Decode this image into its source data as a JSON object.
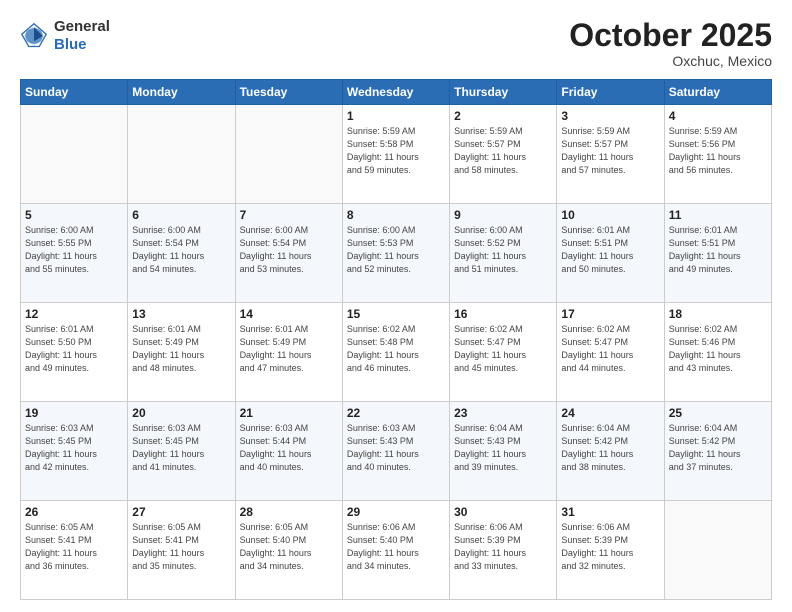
{
  "header": {
    "logo_general": "General",
    "logo_blue": "Blue",
    "month_title": "October 2025",
    "location": "Oxchuc, Mexico"
  },
  "weekdays": [
    "Sunday",
    "Monday",
    "Tuesday",
    "Wednesday",
    "Thursday",
    "Friday",
    "Saturday"
  ],
  "weeks": [
    [
      {
        "day": "",
        "info": ""
      },
      {
        "day": "",
        "info": ""
      },
      {
        "day": "",
        "info": ""
      },
      {
        "day": "1",
        "info": "Sunrise: 5:59 AM\nSunset: 5:58 PM\nDaylight: 11 hours\nand 59 minutes."
      },
      {
        "day": "2",
        "info": "Sunrise: 5:59 AM\nSunset: 5:57 PM\nDaylight: 11 hours\nand 58 minutes."
      },
      {
        "day": "3",
        "info": "Sunrise: 5:59 AM\nSunset: 5:57 PM\nDaylight: 11 hours\nand 57 minutes."
      },
      {
        "day": "4",
        "info": "Sunrise: 5:59 AM\nSunset: 5:56 PM\nDaylight: 11 hours\nand 56 minutes."
      }
    ],
    [
      {
        "day": "5",
        "info": "Sunrise: 6:00 AM\nSunset: 5:55 PM\nDaylight: 11 hours\nand 55 minutes."
      },
      {
        "day": "6",
        "info": "Sunrise: 6:00 AM\nSunset: 5:54 PM\nDaylight: 11 hours\nand 54 minutes."
      },
      {
        "day": "7",
        "info": "Sunrise: 6:00 AM\nSunset: 5:54 PM\nDaylight: 11 hours\nand 53 minutes."
      },
      {
        "day": "8",
        "info": "Sunrise: 6:00 AM\nSunset: 5:53 PM\nDaylight: 11 hours\nand 52 minutes."
      },
      {
        "day": "9",
        "info": "Sunrise: 6:00 AM\nSunset: 5:52 PM\nDaylight: 11 hours\nand 51 minutes."
      },
      {
        "day": "10",
        "info": "Sunrise: 6:01 AM\nSunset: 5:51 PM\nDaylight: 11 hours\nand 50 minutes."
      },
      {
        "day": "11",
        "info": "Sunrise: 6:01 AM\nSunset: 5:51 PM\nDaylight: 11 hours\nand 49 minutes."
      }
    ],
    [
      {
        "day": "12",
        "info": "Sunrise: 6:01 AM\nSunset: 5:50 PM\nDaylight: 11 hours\nand 49 minutes."
      },
      {
        "day": "13",
        "info": "Sunrise: 6:01 AM\nSunset: 5:49 PM\nDaylight: 11 hours\nand 48 minutes."
      },
      {
        "day": "14",
        "info": "Sunrise: 6:01 AM\nSunset: 5:49 PM\nDaylight: 11 hours\nand 47 minutes."
      },
      {
        "day": "15",
        "info": "Sunrise: 6:02 AM\nSunset: 5:48 PM\nDaylight: 11 hours\nand 46 minutes."
      },
      {
        "day": "16",
        "info": "Sunrise: 6:02 AM\nSunset: 5:47 PM\nDaylight: 11 hours\nand 45 minutes."
      },
      {
        "day": "17",
        "info": "Sunrise: 6:02 AM\nSunset: 5:47 PM\nDaylight: 11 hours\nand 44 minutes."
      },
      {
        "day": "18",
        "info": "Sunrise: 6:02 AM\nSunset: 5:46 PM\nDaylight: 11 hours\nand 43 minutes."
      }
    ],
    [
      {
        "day": "19",
        "info": "Sunrise: 6:03 AM\nSunset: 5:45 PM\nDaylight: 11 hours\nand 42 minutes."
      },
      {
        "day": "20",
        "info": "Sunrise: 6:03 AM\nSunset: 5:45 PM\nDaylight: 11 hours\nand 41 minutes."
      },
      {
        "day": "21",
        "info": "Sunrise: 6:03 AM\nSunset: 5:44 PM\nDaylight: 11 hours\nand 40 minutes."
      },
      {
        "day": "22",
        "info": "Sunrise: 6:03 AM\nSunset: 5:43 PM\nDaylight: 11 hours\nand 40 minutes."
      },
      {
        "day": "23",
        "info": "Sunrise: 6:04 AM\nSunset: 5:43 PM\nDaylight: 11 hours\nand 39 minutes."
      },
      {
        "day": "24",
        "info": "Sunrise: 6:04 AM\nSunset: 5:42 PM\nDaylight: 11 hours\nand 38 minutes."
      },
      {
        "day": "25",
        "info": "Sunrise: 6:04 AM\nSunset: 5:42 PM\nDaylight: 11 hours\nand 37 minutes."
      }
    ],
    [
      {
        "day": "26",
        "info": "Sunrise: 6:05 AM\nSunset: 5:41 PM\nDaylight: 11 hours\nand 36 minutes."
      },
      {
        "day": "27",
        "info": "Sunrise: 6:05 AM\nSunset: 5:41 PM\nDaylight: 11 hours\nand 35 minutes."
      },
      {
        "day": "28",
        "info": "Sunrise: 6:05 AM\nSunset: 5:40 PM\nDaylight: 11 hours\nand 34 minutes."
      },
      {
        "day": "29",
        "info": "Sunrise: 6:06 AM\nSunset: 5:40 PM\nDaylight: 11 hours\nand 34 minutes."
      },
      {
        "day": "30",
        "info": "Sunrise: 6:06 AM\nSunset: 5:39 PM\nDaylight: 11 hours\nand 33 minutes."
      },
      {
        "day": "31",
        "info": "Sunrise: 6:06 AM\nSunset: 5:39 PM\nDaylight: 11 hours\nand 32 minutes."
      },
      {
        "day": "",
        "info": ""
      }
    ]
  ]
}
